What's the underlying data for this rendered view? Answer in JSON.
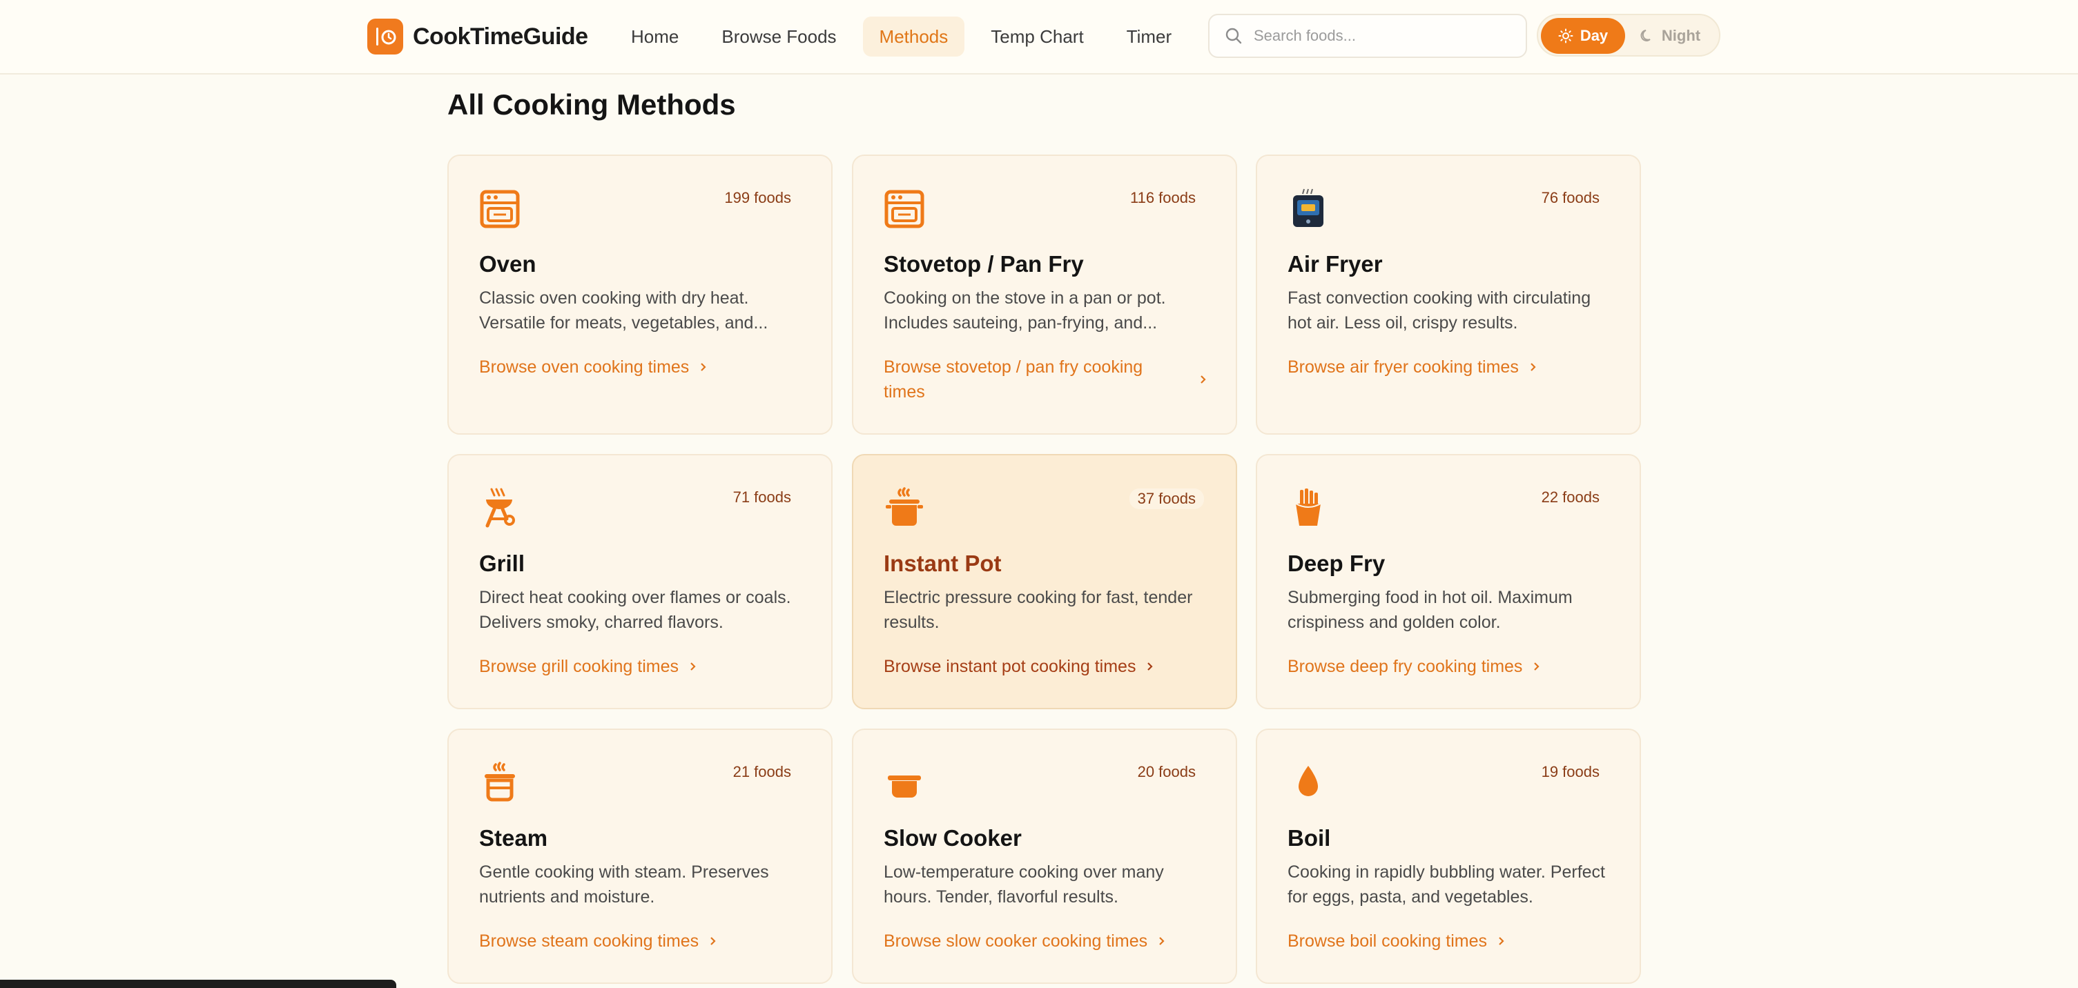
{
  "header": {
    "logo_text": "CookTimeGuide",
    "nav": [
      "Home",
      "Browse Foods",
      "Methods",
      "Temp Chart",
      "Timer"
    ],
    "active_nav": "Methods",
    "search_placeholder": "Search foods...",
    "theme": {
      "day_label": "Day",
      "night_label": "Night",
      "selected": "Day"
    }
  },
  "page_title": "All Cooking Methods",
  "colors": {
    "accent": "#ef7a18",
    "background": "#fdfbf3",
    "card": "#fdf6ea",
    "count_text": "#8a3c16"
  },
  "methods": [
    {
      "icon": "oven-icon",
      "count": "199 foods",
      "name": "Oven",
      "desc": "Classic oven cooking with dry heat. Versatile for meats, vegetables, and...",
      "link": "Browse oven cooking times"
    },
    {
      "icon": "stovetop-icon",
      "count": "116 foods",
      "name": "Stovetop / Pan Fry",
      "desc": "Cooking on the stove in a pan or pot. Includes sauteing, pan-frying, and...",
      "link": "Browse stovetop / pan fry cooking times"
    },
    {
      "icon": "air-fryer-icon",
      "count": "76 foods",
      "name": "Air Fryer",
      "desc": "Fast convection cooking with circulating hot air. Less oil, crispy results.",
      "link": "Browse air fryer cooking times"
    },
    {
      "icon": "grill-icon",
      "count": "71 foods",
      "name": "Grill",
      "desc": "Direct heat cooking over flames or coals. Delivers smoky, charred flavors.",
      "link": "Browse grill cooking times"
    },
    {
      "icon": "instant-pot-icon",
      "count": "37 foods",
      "name": "Instant Pot",
      "desc": "Electric pressure cooking for fast, tender results.",
      "link": "Browse instant pot cooking times"
    },
    {
      "icon": "deep-fry-icon",
      "count": "22 foods",
      "name": "Deep Fry",
      "desc": "Submerging food in hot oil. Maximum crispiness and golden color.",
      "link": "Browse deep fry cooking times"
    },
    {
      "icon": "steam-icon",
      "count": "21 foods",
      "name": "Steam",
      "desc": "Gentle cooking with steam. Preserves nutrients and moisture.",
      "link": "Browse steam cooking times"
    },
    {
      "icon": "slow-cooker-icon",
      "count": "20 foods",
      "name": "Slow Cooker",
      "desc": "Low-temperature cooking over many hours. Tender, flavorful results.",
      "link": "Browse slow cooker cooking times"
    },
    {
      "icon": "boil-icon",
      "count": "19 foods",
      "name": "Boil",
      "desc": "Cooking in rapidly bubbling water. Perfect for eggs, pasta, and vegetables.",
      "link": "Browse boil cooking times"
    }
  ]
}
